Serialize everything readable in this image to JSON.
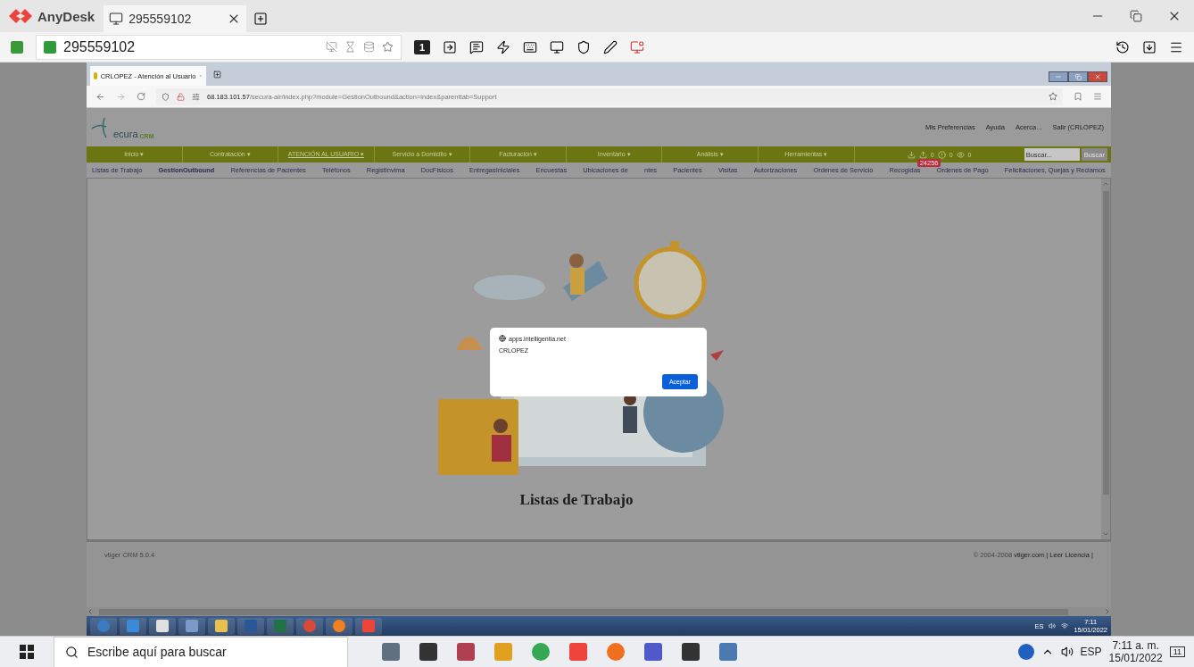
{
  "anydesk": {
    "brand": "AnyDesk",
    "tab": {
      "title": "295559102"
    },
    "address": "295559102",
    "monitor_number": "1"
  },
  "browser": {
    "tab_title": "CRLOPEZ - Atención al Usuario",
    "url_host": "68.183.101.57",
    "url_path": "/secura-air/index.php?module=GestionOutbound&action=index&parenttab=Support"
  },
  "crm": {
    "logo_main": "ecura",
    "logo_sub": "CRM",
    "header_links": [
      "Mis Preferencias",
      "Ayuda",
      "Acerca...",
      "Salir (CRLOPEZ)"
    ],
    "nav": [
      {
        "label": "Inicio ▾",
        "selected": false
      },
      {
        "label": "Contratación ▾",
        "selected": false
      },
      {
        "label": "ATENCIÓN AL USUARIO ▾",
        "selected": true
      },
      {
        "label": "Servicio a Domicilio ▾",
        "selected": false
      },
      {
        "label": "Facturación ▾",
        "selected": false
      },
      {
        "label": "Inventario ▾",
        "selected": false
      },
      {
        "label": "Análisis ▾",
        "selected": false
      },
      {
        "label": "Herramientas ▾",
        "selected": false
      }
    ],
    "badge": "24256",
    "counts": [
      "0",
      "0",
      "0"
    ],
    "search": {
      "placeholder": "Buscar...",
      "button": "Buscar"
    },
    "subnav": [
      {
        "label": "Listas de Trabajo",
        "selected": false
      },
      {
        "label": "GestionOutbound",
        "selected": true
      },
      {
        "label": "Referencias de Pacientes",
        "selected": false
      },
      {
        "label": "Teléfonos",
        "selected": false
      },
      {
        "label": "RegistInvima",
        "selected": false
      },
      {
        "label": "DocFisicos",
        "selected": false
      },
      {
        "label": "EntregasIniciales",
        "selected": false
      },
      {
        "label": "Encuestas",
        "selected": false
      },
      {
        "label": "Ubicaciones de",
        "selected": false
      },
      {
        "label": "ntes",
        "selected": false
      },
      {
        "label": "Pacientes",
        "selected": false
      },
      {
        "label": "Visitas",
        "selected": false
      },
      {
        "label": "Autorizaciones",
        "selected": false
      },
      {
        "label": "Ordenes de Servicio",
        "selected": false
      },
      {
        "label": "Recogidas",
        "selected": false
      },
      {
        "label": "Ordenes de Pago",
        "selected": false
      },
      {
        "label": "Felicitaciones, Quejas y Reclamos",
        "selected": false
      }
    ],
    "heading": "Listas de Trabajo",
    "footer_left": "vtiger CRM 5.0.4",
    "footer_copyright": "© 2004-2008",
    "footer_link": "vtiger.com",
    "footer_license": "| Leer Licencia |"
  },
  "dialog": {
    "origin": "apps.intelligentia.net",
    "message": "CRLOPEZ",
    "button": "Aceptar"
  },
  "remote_taskbar": {
    "lang": "ES",
    "time": "7:11",
    "date": "15/01/2022"
  },
  "taskbar": {
    "search_placeholder": "Escribe aquí para buscar",
    "lang": "ESP",
    "time": "7:11 a. m.",
    "date": "15/01/2022",
    "notifications": "11"
  }
}
